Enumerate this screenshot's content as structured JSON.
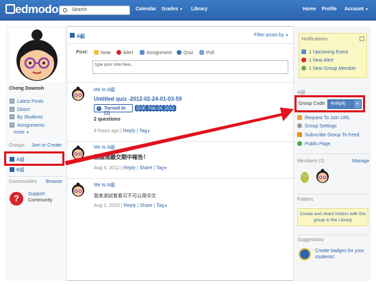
{
  "topbar": {
    "logo": "edmodo",
    "search_placeholder": "Search",
    "nav": [
      "Calendar",
      "Grades",
      "Library",
      "Home",
      "Profile",
      "Account"
    ]
  },
  "sidebar": {
    "user_name": "Cheng Downoh",
    "links": [
      "Latest Posts",
      "Direct",
      "By Students",
      "Assignments",
      "more"
    ],
    "groups_title": "Groups",
    "join_or_create": "Join or Create",
    "groups": [
      "A組",
      "B組"
    ],
    "communities_title": "Communities",
    "browse": "Browse",
    "support_label": "Support",
    "community_label": "Community"
  },
  "feed": {
    "group_title": "A組",
    "filter_label": "Filter posts by",
    "post_label": "Post:",
    "post_types": [
      "Note",
      "Alert",
      "Assignment",
      "Quiz",
      "Poll"
    ],
    "input_placeholder": "type your note here...",
    "posts": [
      {
        "meta": "Me to A組",
        "title": "Untitled quiz -2012-02-24-01-03-59",
        "turned_in": "Turned In (1)",
        "due": "DUE: Feb 24, 2012",
        "questions": "2 questions",
        "time": "8 hours ago",
        "actions": [
          "Reply",
          "Tag"
        ]
      },
      {
        "meta": "Me to A組",
        "content": "請盡速繳交期中報告！",
        "time": "Aug 4, 2011",
        "actions": [
          "Reply",
          "Share",
          "Tag"
        ]
      },
      {
        "meta": "Me to A組",
        "content": "我來測試看看可不可以用中文",
        "time": "Aug 2, 2010",
        "actions": [
          "Reply",
          "Share",
          "Tag"
        ]
      }
    ]
  },
  "right": {
    "notifications_title": "Notifications",
    "notifications": [
      "1 Upcoming Event",
      "1 New Alert",
      "1 New Group Member"
    ],
    "group_name": "A組",
    "group_code_label": "Group Code:",
    "group_code": "4n8q4j",
    "group_links": [
      "Request To Join URL",
      "Group Settings",
      "Subscribe Group To Feed",
      "Public Page"
    ],
    "members_title": "Members",
    "members_count": "(2)",
    "manage": "Manage",
    "folders_title": "Folders",
    "folders_text": "Create and share folders with this group in the Library",
    "suggestions_title": "Suggestions",
    "suggestion_text": "Create badges for your students!"
  },
  "colors": {
    "brand": "#2d64ad",
    "highlight": "#e0121e"
  }
}
